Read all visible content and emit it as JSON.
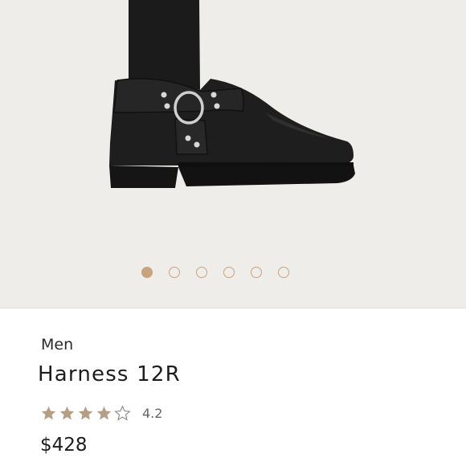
{
  "product": {
    "category": "Men",
    "name": "Harness 12R",
    "rating": 4.2,
    "rating_label": "4.2",
    "stars_filled": 4,
    "stars_total": 5,
    "price": "$428"
  },
  "gallery": {
    "image_count": 6,
    "active_index": 0,
    "icon": "boot-product-image"
  },
  "colors": {
    "accent": "#c9a27f",
    "hero_bg": "#efede9",
    "boot": "#1c1c1c"
  }
}
